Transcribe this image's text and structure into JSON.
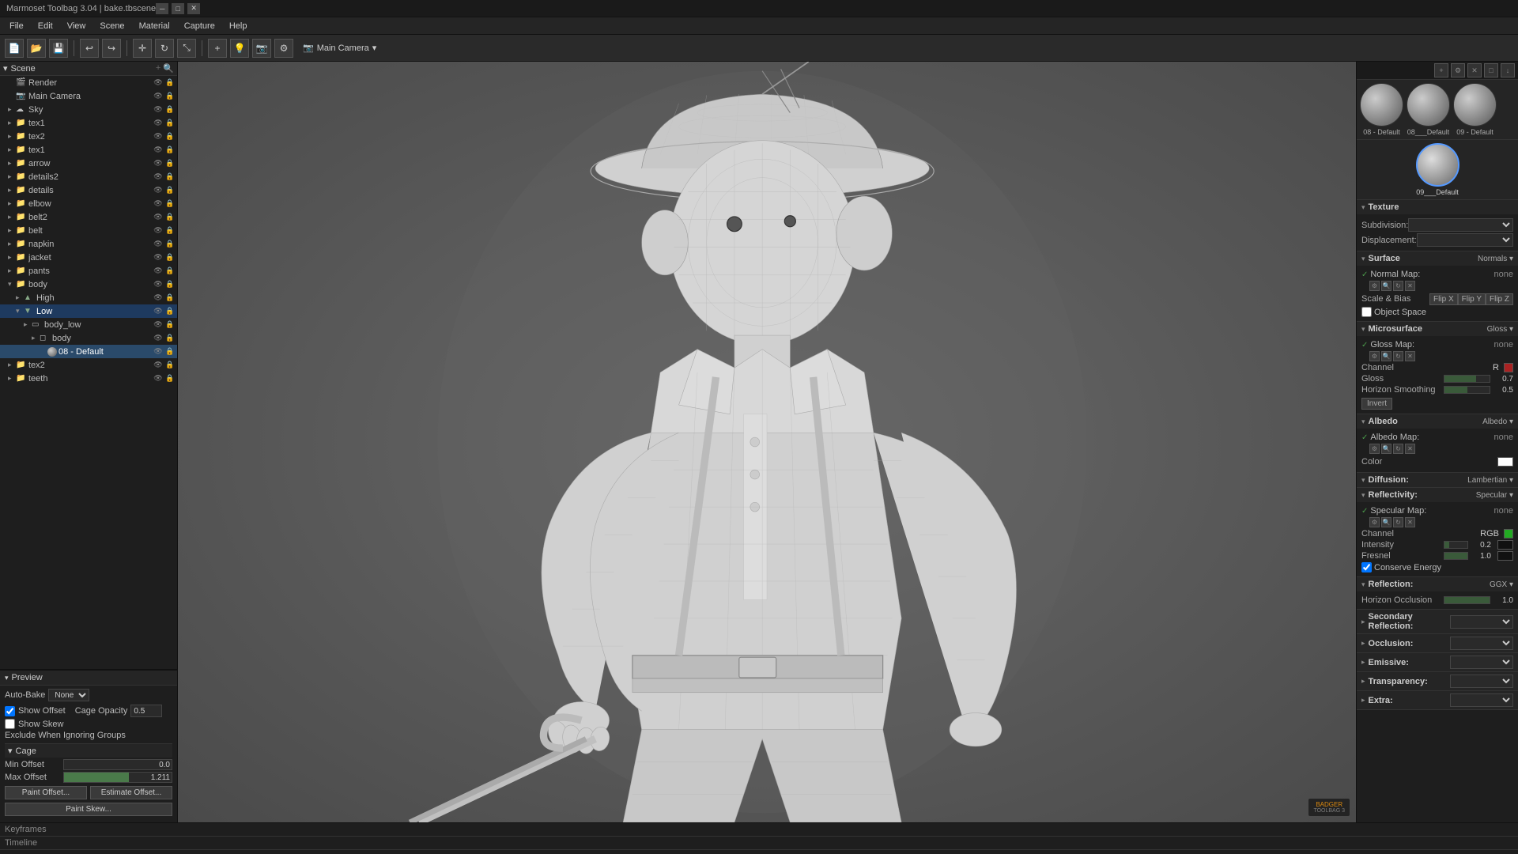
{
  "titlebar": {
    "title": "Marmoset Toolbag 3.04 | bake.tbscene",
    "btn_minimize": "─",
    "btn_maximize": "□",
    "btn_close": "✕"
  },
  "menubar": {
    "items": [
      "File",
      "Edit",
      "View",
      "Scene",
      "Material",
      "Capture",
      "Help"
    ]
  },
  "toolbar": {
    "viewport_label": "Main Camera",
    "viewport_arrow": "▾"
  },
  "scene_tree": {
    "section": "Scene",
    "items": [
      {
        "label": "Render",
        "depth": 1,
        "type": "render",
        "arrow": ""
      },
      {
        "label": "Main Camera",
        "depth": 1,
        "type": "camera",
        "arrow": ""
      },
      {
        "label": "Sky",
        "depth": 1,
        "type": "sky",
        "arrow": "▸"
      },
      {
        "label": "tex1",
        "depth": 1,
        "type": "folder",
        "arrow": "▸"
      },
      {
        "label": "tex2",
        "depth": 1,
        "type": "folder",
        "arrow": "▸"
      },
      {
        "label": "tex1",
        "depth": 1,
        "type": "folder",
        "arrow": "▸"
      },
      {
        "label": "arrow",
        "depth": 1,
        "type": "folder",
        "arrow": "▸"
      },
      {
        "label": "details2",
        "depth": 1,
        "type": "folder",
        "arrow": "▸"
      },
      {
        "label": "details",
        "depth": 1,
        "type": "folder",
        "arrow": "▸"
      },
      {
        "label": "elbow",
        "depth": 1,
        "type": "folder",
        "arrow": "▸"
      },
      {
        "label": "belt2",
        "depth": 1,
        "type": "folder",
        "arrow": "▸"
      },
      {
        "label": "belt",
        "depth": 1,
        "type": "folder",
        "arrow": "▸"
      },
      {
        "label": "napkin",
        "depth": 1,
        "type": "folder",
        "arrow": "▸"
      },
      {
        "label": "jacket",
        "depth": 1,
        "type": "folder",
        "arrow": "▸"
      },
      {
        "label": "pants",
        "depth": 1,
        "type": "folder",
        "arrow": "▸"
      },
      {
        "label": "body",
        "depth": 1,
        "type": "folder",
        "arrow": "▾"
      },
      {
        "label": "High",
        "depth": 2,
        "type": "sub",
        "arrow": "▸",
        "selected": false
      },
      {
        "label": "Low",
        "depth": 2,
        "type": "sub",
        "arrow": "▾",
        "selected": true
      },
      {
        "label": "body_low",
        "depth": 3,
        "type": "mesh",
        "arrow": "▸"
      },
      {
        "label": "body",
        "depth": 4,
        "type": "mesh2",
        "arrow": "▸"
      },
      {
        "label": "08 - Default",
        "depth": 5,
        "type": "material",
        "arrow": "",
        "selected_light": true
      },
      {
        "label": "tex2",
        "depth": 1,
        "type": "folder",
        "arrow": "▸"
      },
      {
        "label": "teeth",
        "depth": 1,
        "type": "folder",
        "arrow": "▸"
      }
    ]
  },
  "preview_panel": {
    "label": "Preview",
    "auto_bake_label": "Auto-Bake",
    "auto_bake_value": "None",
    "show_offset_label": "Show Offset",
    "show_skew_label": "Show Skew",
    "exclude_groups_label": "Exclude When Ignoring Groups",
    "cage_section": "Cage",
    "cage_opacity_label": "Cage Opacity",
    "cage_opacity_value": "0.5",
    "min_offset_label": "Min Offset",
    "min_offset_value": "0.0",
    "max_offset_label": "Max Offset",
    "max_offset_value": "1.211",
    "paint_offset_btn": "Paint Offset...",
    "estimate_offset_btn": "Estimate Offset...",
    "paint_skew_btn": "Paint Skew..."
  },
  "material_balls": [
    {
      "label": "08 - Default",
      "selected": false
    },
    {
      "label": "08___Default",
      "selected": false
    },
    {
      "label": "09 - Default",
      "selected": false
    }
  ],
  "material_selected": {
    "label": "09___Default"
  },
  "right_panel": {
    "texture_section": {
      "title": "Texture",
      "subdivision_label": "Subdivision:",
      "displacement_label": "Displacement:"
    },
    "surface_section": {
      "title": "Surface",
      "value": "Normals ▾",
      "normal_map_label": "Normal Map:",
      "normal_map_value": "none",
      "scale_bias_label": "Scale & Bias",
      "flip_x_btn": "Flip X",
      "flip_y_btn": "Flip Y",
      "flip_z_btn": "Flip Z",
      "object_space_label": "Object Space"
    },
    "microsurface_section": {
      "title": "Microsurface",
      "value": "Gloss ▾",
      "gloss_map_label": "Gloss Map:",
      "gloss_map_value": "none",
      "channel_label": "Channel",
      "channel_value": "R",
      "gloss_label": "Gloss",
      "gloss_value": "0.7",
      "horizon_smoothing_label": "Horizon Smoothing",
      "horizon_smoothing_value": "0.5",
      "invert_btn": "Invert"
    },
    "albedo_section": {
      "title": "Albedo",
      "value": "Albedo ▾",
      "albedo_map_label": "Albedo Map:",
      "albedo_map_value": "none",
      "color_label": "Color"
    },
    "diffusion_section": {
      "title": "Diffusion:",
      "value": "Lambertian ▾"
    },
    "reflectivity_section": {
      "title": "Reflectivity:",
      "value": "Specular ▾",
      "specular_map_label": "Specular Map:",
      "specular_map_value": "none",
      "channel_label": "Channel",
      "channel_value": "RGB",
      "intensity_label": "Intensity",
      "intensity_value": "0.2",
      "fresnel_label": "Fresnel",
      "fresnel_value": "1.0",
      "conserve_energy_label": "Conserve Energy"
    },
    "reflection_section": {
      "title": "Reflection:",
      "value": "GGX ▾",
      "horizon_occlusion_label": "Horizon Occlusion",
      "horizon_occlusion_value": "1.0",
      "secondary_reflection_label": "Secondary Reflection:",
      "occlusion_label": "Occlusion:",
      "emissive_label": "Emissive:",
      "transparency_label": "Transparency:",
      "extra_label": "Extra:"
    }
  },
  "bottom": {
    "keyframes_label": "Keyframes",
    "timeline_label": "Timeline"
  },
  "icons": {
    "arrow_right": "▸",
    "arrow_down": "▾",
    "check": "✓",
    "gear": "⚙",
    "eye": "👁",
    "folder": "📁",
    "scene": "🎬"
  }
}
